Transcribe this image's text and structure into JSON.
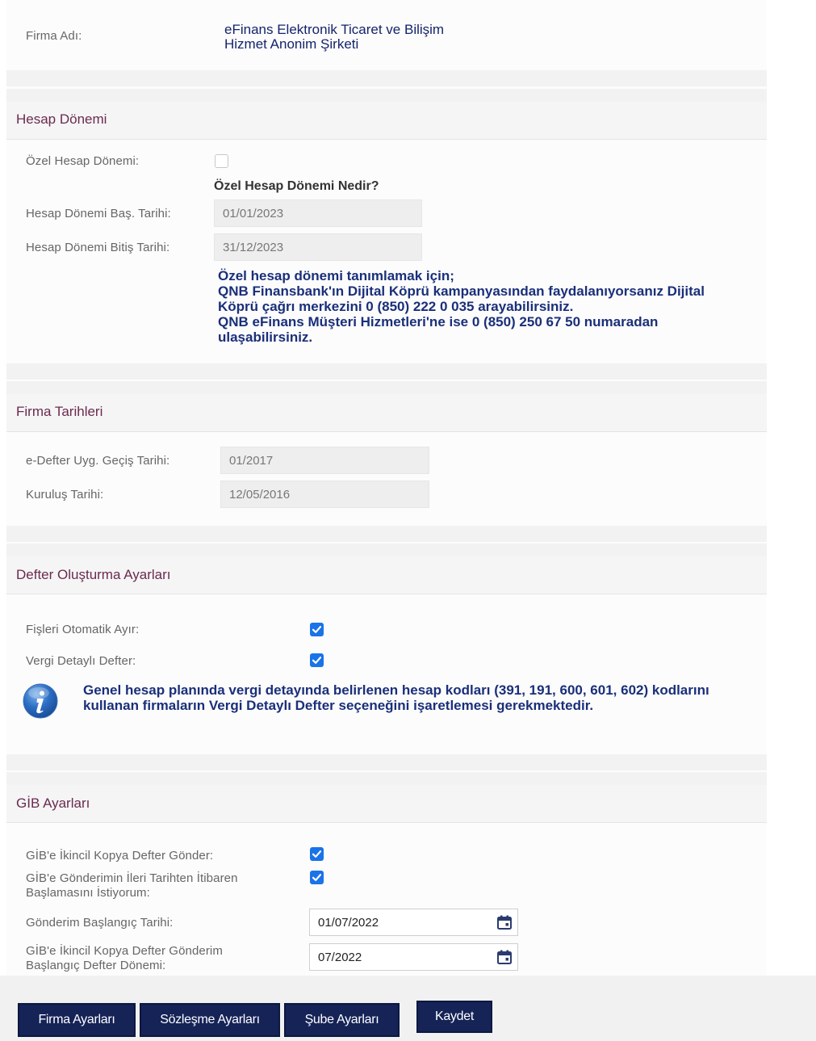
{
  "company": {
    "label": "Firma Adı:",
    "name_line1": "eFinans Elektronik Ticaret ve Bilişim",
    "name_line2": "Hizmet Anonim Şirketi"
  },
  "hesap_donemi": {
    "title": "Hesap Dönemi",
    "ozel_label": "Özel Hesap Dönemi:",
    "ozel_checked": false,
    "nedir_link": "Özel Hesap Dönemi Nedir?",
    "bas_label": "Hesap Dönemi Baş. Tarihi:",
    "bas_value": "01/01/2023",
    "bitis_label": "Hesap Dönemi Bitiş Tarihi:",
    "bitis_value": "31/12/2023",
    "info_lines": [
      "Özel hesap dönemi tanımlamak için;",
      "QNB Finansbank'ın Dijital Köprü kampanyasından faydalanıyorsanız Dijital",
      "Köprü çağrı merkezini 0 (850) 222 0 035 arayabilirsiniz.",
      "QNB eFinans Müşteri Hizmetleri'ne ise 0 (850) 250 67 50 numaradan",
      "ulaşabilirsiniz."
    ]
  },
  "firma_tarihleri": {
    "title": "Firma Tarihleri",
    "edefter_label": "e-Defter Uyg. Geçiş Tarihi:",
    "edefter_value": "01/2017",
    "kurulus_label": "Kuruluş Tarihi:",
    "kurulus_value": "12/05/2016"
  },
  "defter": {
    "title": "Defter Oluşturma Ayarları",
    "fis_label": "Fişleri Otomatik Ayır:",
    "fis_checked": true,
    "vergi_label": "Vergi Detaylı Defter:",
    "vergi_checked": true,
    "info_line1": "Genel hesap planında vergi detayında belirlenen hesap kodları (391, 191, 600, 601, 602) kodlarını",
    "info_line2": "kullanan firmaların Vergi Detaylı Defter seçeneğini işaretlemesi gerekmektedir."
  },
  "gib": {
    "title": "GİB Ayarları",
    "ikincil_label": "GİB'e İkincil Kopya Defter Gönder:",
    "ikincil_checked": true,
    "ileri_label_1": "GİB'e Gönderimin İleri Tarihten İtibaren",
    "ileri_label_2": "Başlamasını İstiyorum:",
    "ileri_checked": true,
    "baslangic_label": "Gönderim Başlangıç Tarihi:",
    "baslangic_value": "01/07/2022",
    "donem_label_1": "GİB'e İkincil Kopya Defter Gönderim",
    "donem_label_2": "Başlangıç Defter Dönemi:",
    "donem_value": "07/2022"
  },
  "buttons": {
    "firma": "Firma Ayarları",
    "sozlesme": "Sözleşme Ayarları",
    "sube": "Şube Ayarları",
    "kaydet": "Kaydet"
  },
  "colors": {
    "section_title": "#6b2a4f",
    "button_bg": "#152357",
    "checkbox": "#1a73e8",
    "info_text": "#1a2f7a"
  }
}
